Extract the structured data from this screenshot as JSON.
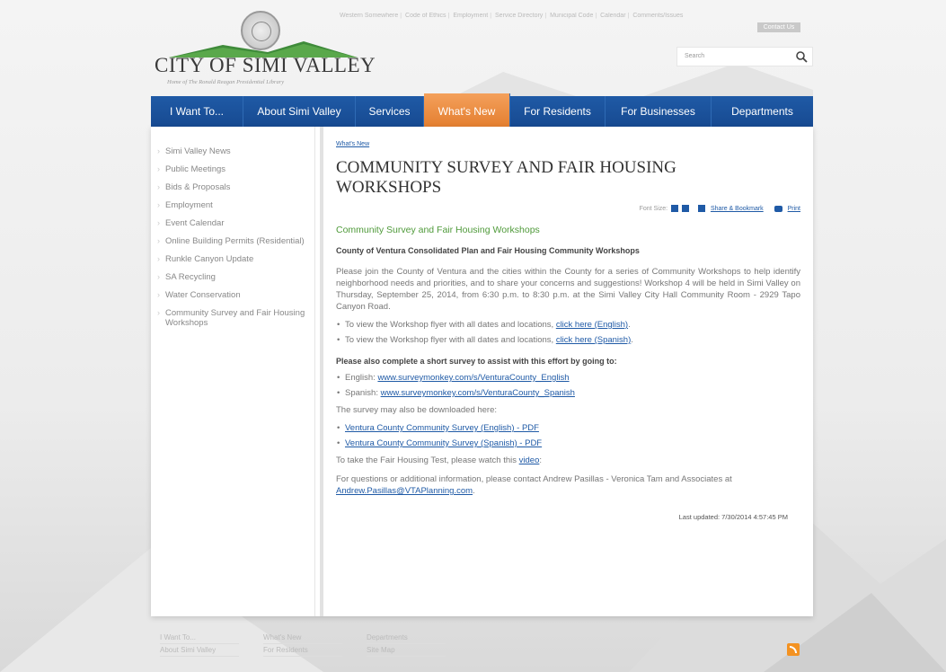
{
  "header": {
    "top_links": [
      "Western Somewhere",
      "Code of Ethics",
      "Employment",
      "Service Directory",
      "Municipal Code",
      "Calendar",
      "Comments/Issues"
    ],
    "contact_label": "Contact Us",
    "title": "CITY OF SIMI VALLEY",
    "subtitle": "Home of The Ronald Reagan Presidential Library",
    "search_placeholder": "Search"
  },
  "nav": {
    "items": [
      {
        "label": "I Want To..."
      },
      {
        "label": "About Simi Valley"
      },
      {
        "label": "Services"
      },
      {
        "label": "What's New"
      },
      {
        "label": "For Residents"
      },
      {
        "label": "For Businesses"
      },
      {
        "label": "Departments"
      }
    ]
  },
  "sidebar": {
    "items": [
      {
        "label": "Simi Valley News"
      },
      {
        "label": "Public Meetings"
      },
      {
        "label": "Bids & Proposals"
      },
      {
        "label": "Employment"
      },
      {
        "label": "Event Calendar"
      },
      {
        "label": "Online Building Permits (Residential)"
      },
      {
        "label": "Runkle Canyon Update"
      },
      {
        "label": "SA Recycling"
      },
      {
        "label": "Water Conservation"
      },
      {
        "label": "Community Survey and Fair Housing Workshops"
      }
    ]
  },
  "main": {
    "breadcrumb": "What's New",
    "title": "COMMUNITY SURVEY AND FAIR HOUSING WORKSHOPS",
    "font_size_label": "Font Size:",
    "share_label": "Share & Bookmark",
    "print_label": "Print",
    "subhead": "Community Survey and Fair Housing Workshops",
    "intro_bold": "County of Ventura Consolidated Plan and Fair Housing Community Workshops",
    "paragraph": "Please join the County of Ventura and the cities within the County for a series of Community Workshops to help identify neighborhood needs and priorities, and to share your concerns and suggestions! Workshop 4 will be held in Simi Valley on Thursday, September 25, 2014, from 6:30 p.m. to 8:30 p.m. at the Simi Valley City Hall Community Room - 2929 Tapo Canyon Road.",
    "flyer_text": "To view the Workshop flyer with all dates and locations, ",
    "flyer_en_link": "click here (English)",
    "flyer_es_link": "click here (Spanish)",
    "survey_bold": "Please also complete a short survey to assist with this effort by going to:",
    "english_label": "English: ",
    "english_link": "www.surveymonkey.com/s/VenturaCounty_English",
    "spanish_label": "Spanish: ",
    "spanish_link": "www.surveymonkey.com/s/VenturaCounty_Spanish",
    "download_text": "The survey may also be downloaded here:",
    "pdf_en": "Ventura County Community Survey (English) - PDF",
    "pdf_es": "Ventura County Community Survey (Spanish) - PDF",
    "video_text": "To take the Fair Housing Test, please watch this ",
    "video_link": "video",
    "contact_text": "For questions or additional information, please contact Andrew Pasillas - Veronica Tam and Associates at",
    "contact_email": "Andrew.Pasillas@VTAPlanning.com",
    "updated": "Last updated: 7/30/2014 4:57:45 PM"
  },
  "footer": {
    "col1": [
      "I Want To...",
      "About Simi Valley"
    ],
    "col2": [
      "What's New",
      "For Residents"
    ],
    "col3": [
      "Departments",
      "Site Map"
    ]
  },
  "colors": {
    "nav_blue": "#1f5aa6",
    "nav_active": "#e37d2e",
    "subhead_green": "#4f9a3a"
  }
}
